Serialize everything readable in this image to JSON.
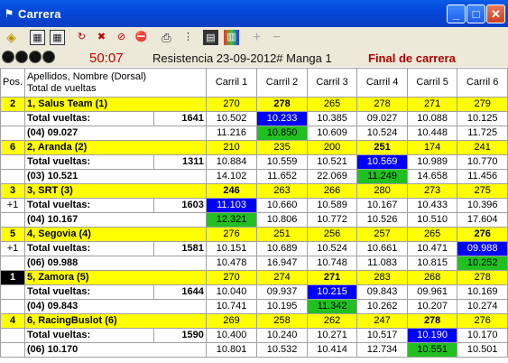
{
  "window": {
    "title": "Carrera",
    "min": "_",
    "max": "□",
    "close": "✕"
  },
  "status": {
    "timer": "50:07",
    "session": "Resistencia 23-09-2012# Manga 1",
    "final": "Final de carrera"
  },
  "header": {
    "pos": "Pos.",
    "name1": "Apellidos, Nombre (Dorsal)",
    "name2": "Total de vueltas",
    "lanes": [
      "Carril 1",
      "Carril 2",
      "Carril 3",
      "Carril 4",
      "Carril 5",
      "Carril 6"
    ]
  },
  "rows": [
    {
      "pos": "2",
      "name": "1, Salus Team (1)",
      "total_label": "Total vueltas:",
      "total": "1641",
      "best": "(04) 09.027",
      "laps": [
        "270",
        "278",
        "265",
        "278",
        "271",
        "279"
      ],
      "r2": [
        "10.502",
        "10.233",
        "10.385",
        "09.027",
        "10.088",
        "10.125"
      ],
      "r3": [
        "11.216",
        "10.850",
        "10.609",
        "10.524",
        "10.448",
        "11.725"
      ]
    },
    {
      "pos": "6",
      "name": "2, Aranda (2)",
      "total_label": "Total vueltas:",
      "total": "1311",
      "best": "(03) 10.521",
      "laps": [
        "210",
        "235",
        "200",
        "251",
        "174",
        "241"
      ],
      "r2": [
        "10.884",
        "10.559",
        "10.521",
        "10.569",
        "10.989",
        "10.770"
      ],
      "r3": [
        "14.102",
        "11.652",
        "22.069",
        "11.249",
        "14.658",
        "11.456"
      ]
    },
    {
      "pos": "3",
      "gap": "+1",
      "name": "3, SRT (3)",
      "total_label": "Total vueltas:",
      "total": "1603",
      "best": "(04) 10.167",
      "laps": [
        "246",
        "263",
        "266",
        "280",
        "273",
        "275"
      ],
      "r2": [
        "11.103",
        "10.660",
        "10.589",
        "10.167",
        "10.433",
        "10.396"
      ],
      "r3": [
        "12.321",
        "10.806",
        "10.772",
        "10.526",
        "10.510",
        "17.604"
      ]
    },
    {
      "pos": "5",
      "gap": "+1",
      "name": "4, Segovia (4)",
      "total_label": "Total vueltas:",
      "total": "1581",
      "best": "(06) 09.988",
      "laps": [
        "276",
        "251",
        "256",
        "257",
        "265",
        "276"
      ],
      "r2": [
        "10.151",
        "10.689",
        "10.524",
        "10.661",
        "10.471",
        "09.988"
      ],
      "r3": [
        "10.478",
        "16.947",
        "10.748",
        "11.083",
        "10.815",
        "10.252"
      ]
    },
    {
      "pos": "1",
      "name": "5, Zamora (5)",
      "total_label": "Total vueltas:",
      "total": "1644",
      "best": "(04) 09.843",
      "laps": [
        "270",
        "274",
        "271",
        "283",
        "268",
        "278"
      ],
      "r2": [
        "10.040",
        "09.937",
        "10.215",
        "09.843",
        "09.961",
        "10.169"
      ],
      "r3": [
        "10.741",
        "10.195",
        "11.342",
        "10.262",
        "10.207",
        "10.274"
      ]
    },
    {
      "pos": "4",
      "name": "6, RacingBuslot (6)",
      "total_label": "Total vueltas:",
      "total": "1590",
      "best": "(06) 10.170",
      "laps": [
        "269",
        "258",
        "262",
        "247",
        "278",
        "276"
      ],
      "r2": [
        "10.400",
        "10.240",
        "10.271",
        "10.517",
        "10.190",
        "10.170"
      ],
      "r3": [
        "10.801",
        "10.532",
        "10.414",
        "12.734",
        "10.551",
        "10.501"
      ]
    }
  ],
  "colors": {
    "yellow": "#ffff00",
    "blue": "#0000ff",
    "green": "#21c021",
    "red": "#c80000"
  }
}
